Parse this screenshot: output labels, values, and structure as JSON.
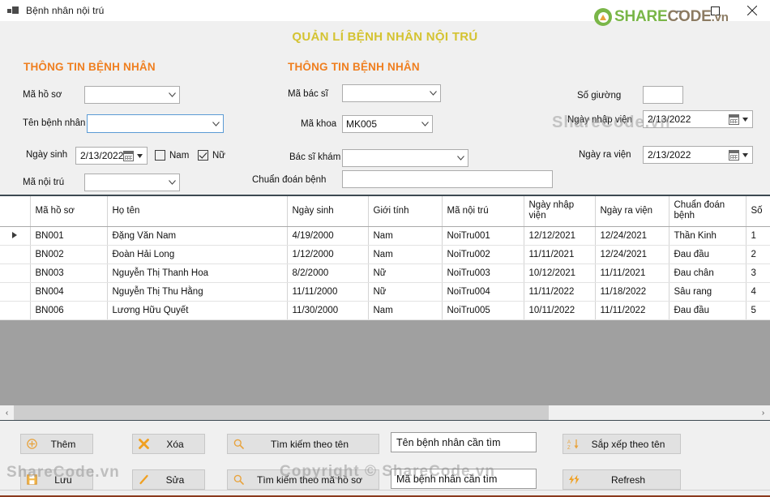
{
  "window": {
    "title": "Bệnh nhân nội trú",
    "icon": "app-window-icon",
    "minimize_label": "—",
    "maximize_label": "□",
    "close_label": "✕"
  },
  "logo": {
    "share": "SHARE",
    "code": "CODE",
    "vn": ".vn"
  },
  "watermarks": {
    "a": "ShareCode.vn",
    "b": "Copyright © ShareCode.vn",
    "c": "ShareCode.vn"
  },
  "header": {
    "main_title": "QUẢN LÍ BỆNH NHÂN NỘI TRÚ",
    "title_color": "#d4c331",
    "section_left": "THÔNG TIN BỆNH NHÂN",
    "section_middle": "THÔNG TIN BỆNH NHÂN",
    "section_color": "#ef7f20"
  },
  "form": {
    "ma_ho_so": {
      "label": "Mã hồ sơ",
      "value": ""
    },
    "ten_benh_nhan": {
      "label": "Tên bệnh nhân",
      "value": ""
    },
    "ngay_sinh": {
      "label": "Ngày sinh",
      "value": "2/13/2022"
    },
    "gender_nam": {
      "label": "Nam",
      "checked": false
    },
    "gender_nu": {
      "label": "Nữ",
      "checked": true
    },
    "ma_noi_tru": {
      "label": "Mã nội trú",
      "value": ""
    },
    "ma_bac_si": {
      "label": "Mã bác sĩ",
      "value": ""
    },
    "ma_khoa": {
      "label": "Mã khoa",
      "value": "MK005"
    },
    "bac_si_kham": {
      "label": "Bác sĩ khám",
      "value": ""
    },
    "chuan_doan_benh": {
      "label": "Chuẩn đoán bệnh",
      "value": ""
    },
    "so_giuong": {
      "label": "Số giường",
      "value": ""
    },
    "ngay_nhap_vien": {
      "label": "Ngày nhập viện",
      "value": "2/13/2022"
    },
    "ngay_ra_vien": {
      "label": "Ngày ra viện",
      "value": "2/13/2022"
    }
  },
  "grid": {
    "columns": [
      "Mã hồ sơ",
      "Họ tên",
      "Ngày sinh",
      "Giới tính",
      "Mã nội trú",
      "Ngày nhập viện",
      "Ngày ra viện",
      "Chuẩn đoán bệnh",
      "Số"
    ],
    "rows": [
      {
        "selected": true,
        "cells": [
          "BN001",
          "Đặng Văn Nam",
          "4/19/2000",
          "Nam",
          "NoiTru001",
          "12/12/2021",
          "12/24/2021",
          "Thần Kinh",
          "1"
        ]
      },
      {
        "selected": false,
        "cells": [
          "BN002",
          "Đoàn Hải Long",
          "1/12/2000",
          "Nam",
          "NoiTru002",
          "11/11/2021",
          "12/24/2021",
          "Đau đầu",
          "2"
        ]
      },
      {
        "selected": false,
        "cells": [
          "BN003",
          "Nguyễn Thị Thanh Hoa",
          "8/2/2000",
          "Nữ",
          "NoiTru003",
          "10/12/2021",
          "11/11/2021",
          "Đau chân",
          "3"
        ]
      },
      {
        "selected": false,
        "cells": [
          "BN004",
          "Nguyễn Thị Thu Hằng",
          "11/11/2000",
          "Nữ",
          "NoiTru004",
          "11/11/2022",
          "11/18/2022",
          "Sâu rang",
          "4"
        ]
      },
      {
        "selected": false,
        "cells": [
          "BN006",
          "Lương Hữu Quyết",
          "11/30/2000",
          "Nam",
          "NoiTru005",
          "10/11/2022",
          "11/11/2022",
          "Đau đầu",
          "5"
        ]
      }
    ]
  },
  "scrollbar": {
    "left_arrow": "‹",
    "right_arrow": "›"
  },
  "actions": {
    "them": {
      "label": "Thêm",
      "icon": "plus-circle-icon"
    },
    "luu": {
      "label": "Lưu",
      "icon": "save-floppy-icon"
    },
    "xoa": {
      "label": "Xóa",
      "icon": "delete-x-icon"
    },
    "sua": {
      "label": "Sửa",
      "icon": "edit-pencil-icon"
    },
    "tim_theo_ten": {
      "label": "Tìm kiếm theo tên",
      "icon": "search-icon"
    },
    "tim_theo_ma": {
      "label": "Tìm kiếm theo mã hồ sơ",
      "icon": "search-icon"
    },
    "sap_xep": {
      "label": "Sắp xếp theo tên",
      "icon": "sort-az-icon"
    },
    "refresh": {
      "label": "Refresh",
      "icon": "refresh-bolt-icon"
    }
  },
  "search": {
    "ten_placeholder": "Tên bệnh nhân cần tìm",
    "ma_placeholder": "Mã bệnh nhân cần tìm"
  }
}
